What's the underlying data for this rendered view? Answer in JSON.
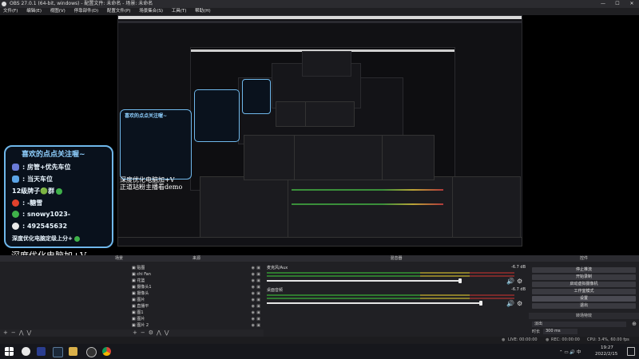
{
  "window": {
    "title": "OBS 27.0.1 (64-bit, windows) - 配置文件: 未命名 - 场景: 未命名",
    "controls": [
      "—",
      "☐",
      "✕"
    ]
  },
  "menu": [
    "文件(F)",
    "编辑(E)",
    "视图(V)",
    "停靠部件(D)",
    "配置文件(P)",
    "场景集合(S)",
    "工具(T)",
    "帮助(H)"
  ],
  "overlay": {
    "title": "喜欢的点点关注喔~",
    "lines": [
      ": 房管+优先车位",
      ": 当天车位",
      "12级牌子🟢群",
      ": -糖雪",
      ": snowy1023-",
      ": 492545632",
      "深度优化电脑定级上分+"
    ]
  },
  "watermark": {
    "line1": "深度优化电脑加+V",
    "line2": "正道站粉主播看demo"
  },
  "docks": {
    "sources_title": "来源",
    "mixer_title": "混音器",
    "controls_title": "控件",
    "transitions_title": "转场特效",
    "scene_tab": "场景",
    "sources": [
      "贴图",
      "chi Fan",
      "花篮",
      "摄像头1",
      "摄像头",
      "图片",
      "直播平",
      "图1",
      "图片",
      "贴图",
      "图片 2"
    ],
    "mixer": [
      {
        "name": "麦克风/Aux",
        "db": "-6.7 dB",
        "level": 0.72
      },
      {
        "name": "桌面音频",
        "db": "-6.7 dB",
        "level": 0.72
      }
    ],
    "controls": [
      "停止推流",
      "开始录制",
      "启动虚拟摄像机",
      "工作室模式",
      "设置",
      "退出"
    ],
    "transition": {
      "name": "淡出",
      "duration_label": "时长",
      "duration": "300 ms"
    }
  },
  "status": {
    "live_label": "LIVE: 00:00:00",
    "rec_label": "REC: 00:00:00",
    "cpu": "CPU: 3.4%, 60.00 fps"
  },
  "taskbar": {
    "time": "19:27",
    "date": "2022/2/15"
  },
  "colors": {
    "overlay_border": "#6fb7ea",
    "overlay_title": "#8fd0ff",
    "meter_green": "#2f7a2f",
    "meter_yellow": "#8a7d2a",
    "meter_red": "#7a2a2a"
  }
}
